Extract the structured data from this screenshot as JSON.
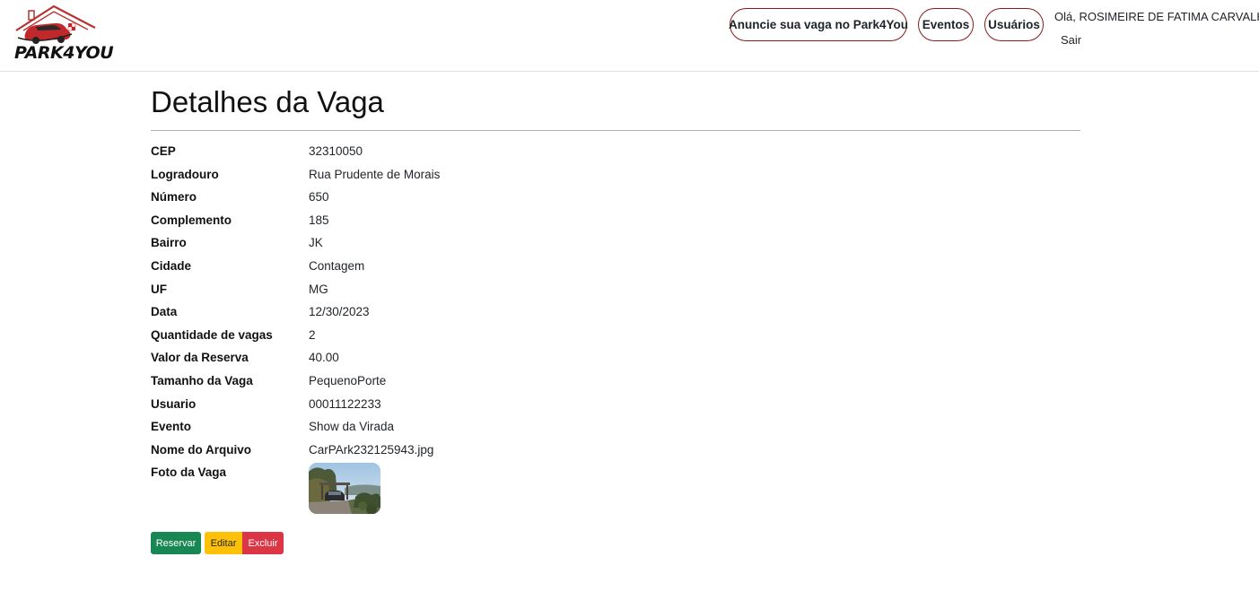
{
  "header": {
    "logo_text": "PARK4YOU",
    "nav": {
      "announce_label": "Anuncie sua vaga no Park4You",
      "events_label": "Eventos",
      "users_label": "Usuários"
    },
    "greeting": "Olá, ROSIMEIRE DE FATIMA CARVALHO",
    "logout_label": "Sair"
  },
  "page": {
    "title": "Detalhes da Vaga"
  },
  "details": [
    {
      "label": "CEP",
      "value": "32310050"
    },
    {
      "label": "Logradouro",
      "value": "Rua Prudente de Morais"
    },
    {
      "label": "Número",
      "value": "650"
    },
    {
      "label": "Complemento",
      "value": "185"
    },
    {
      "label": "Bairro",
      "value": "JK"
    },
    {
      "label": "Cidade",
      "value": "Contagem"
    },
    {
      "label": "UF",
      "value": "MG"
    },
    {
      "label": "Data",
      "value": "12/30/2023"
    },
    {
      "label": "Quantidade de vagas",
      "value": "2"
    },
    {
      "label": "Valor da Reserva",
      "value": "40.00"
    },
    {
      "label": "Tamanho da Vaga",
      "value": "PequenoPorte"
    },
    {
      "label": "Usuario",
      "value": "00011122233"
    },
    {
      "label": "Evento",
      "value": "Show da Virada"
    },
    {
      "label": "Nome do Arquivo",
      "value": "CarPArk232125943.jpg"
    }
  ],
  "photo": {
    "label": "Foto da Vaga"
  },
  "actions": {
    "reserve_label": "Reservar",
    "edit_label": "Editar",
    "delete_label": "Excluir"
  },
  "colors": {
    "brand_red": "#8b1a1a",
    "success": "#198754",
    "warning": "#ffc107",
    "danger": "#dc3545"
  }
}
